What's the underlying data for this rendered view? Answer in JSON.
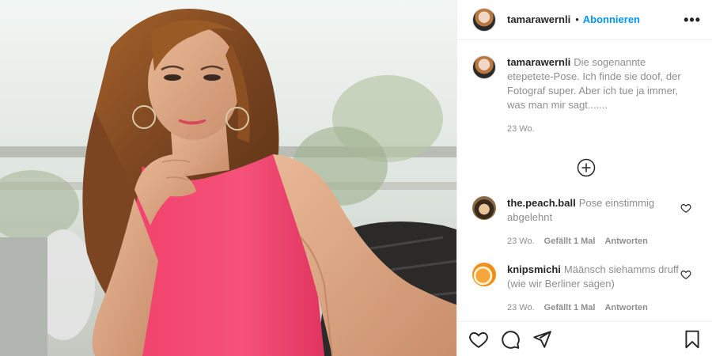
{
  "header": {
    "username": "tamarawernli",
    "separator": "•",
    "follow_label": "Abonnieren",
    "more_label": "•••"
  },
  "caption": {
    "username": "tamarawernli",
    "text": "Die sogenannte etepetete-Pose. Ich finde sie doof, der Fotograf super. Aber ich tue ja immer, was man mir sagt.......",
    "age": "23 Wo."
  },
  "comments": [
    {
      "username": "the.peach.ball",
      "text": "Pose einstimmig abgelehnt",
      "age": "23 Wo.",
      "likes": "Gefällt 1 Mal",
      "reply_label": "Antworten"
    },
    {
      "username": "knipsmichi",
      "text": "Määnsch siehamms druff (wie wir Berliner sagen)",
      "age": "23 Wo.",
      "likes": "Gefällt 1 Mal",
      "reply_label": "Antworten"
    }
  ],
  "icons": {
    "more_comments": "plus-circle-icon",
    "like": "heart-icon",
    "comment": "comment-icon",
    "share": "send-icon",
    "save": "bookmark-icon"
  },
  "colors": {
    "accent": "#0095f6",
    "text": "#262626",
    "muted": "#8e8e8e",
    "dress": "#f2486b"
  }
}
